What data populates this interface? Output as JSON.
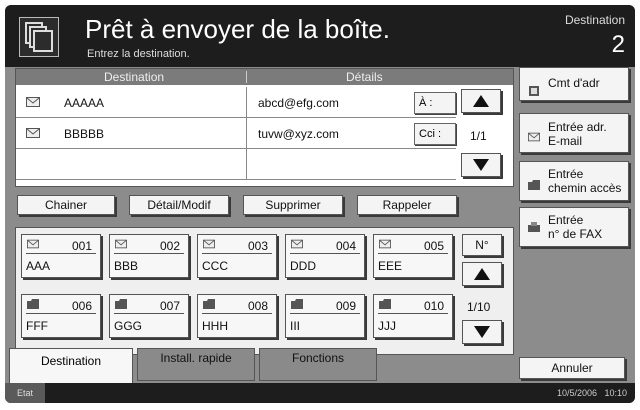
{
  "header": {
    "title": "Prêt à envoyer de la boîte.",
    "subtitle": "Entrez la destination.",
    "destination_label": "Destination",
    "destination_count": "2"
  },
  "list": {
    "col_destination": "Destination",
    "col_details": "Détails",
    "rows": [
      {
        "name": "AAAAA",
        "address": "abcd@efg.com",
        "type": "À :"
      },
      {
        "name": "BBBBB",
        "address": "tuvw@xyz.com",
        "type": "Cci :"
      }
    ],
    "page": "1/1"
  },
  "actions": {
    "chain": "Chainer",
    "detail": "Détail/Modif",
    "delete": "Supprimer",
    "recall": "Rappeler"
  },
  "side": {
    "address_book": "Cmt d'adr",
    "email_entry_1": "Entrée adr.",
    "email_entry_2": "E-mail",
    "path_entry_1": "Entrée",
    "path_entry_2": "chemin accès",
    "fax_entry_1": "Entrée",
    "fax_entry_2": "n° de FAX"
  },
  "keys": [
    {
      "num": "001",
      "name": "AAA",
      "icon": "mail-icon"
    },
    {
      "num": "002",
      "name": "BBB",
      "icon": "mail-icon"
    },
    {
      "num": "003",
      "name": "CCC",
      "icon": "mail-icon"
    },
    {
      "num": "004",
      "name": "DDD",
      "icon": "mail-icon"
    },
    {
      "num": "005",
      "name": "EEE",
      "icon": "mail-icon"
    },
    {
      "num": "006",
      "name": "FFF",
      "icon": "folder-icon"
    },
    {
      "num": "007",
      "name": "GGG",
      "icon": "folder-icon"
    },
    {
      "num": "008",
      "name": "HHH",
      "icon": "folder-icon"
    },
    {
      "num": "009",
      "name": "III",
      "icon": "folder-icon"
    },
    {
      "num": "010",
      "name": "JJJ",
      "icon": "folder-icon"
    }
  ],
  "keys_pager": {
    "number_label": "N°",
    "page": "1/10"
  },
  "tabs": {
    "destination": "Destination",
    "quick": "Install. rapide",
    "functions": "Fonctions"
  },
  "cancel": "Annuler",
  "status": {
    "label": "Etat",
    "datetime": "10/5/2006   10:10"
  }
}
